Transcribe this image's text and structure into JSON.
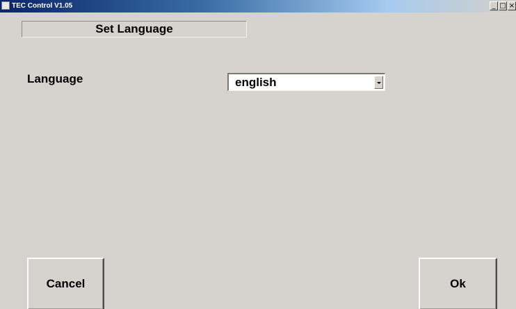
{
  "window": {
    "title": "TEC Control V1.05",
    "icon": "app-icon",
    "controls": {
      "minimize": "_",
      "maximize": "□",
      "close": "×"
    }
  },
  "header": {
    "title": "Set Language"
  },
  "language": {
    "label": "Language",
    "selected": "english"
  },
  "buttons": {
    "cancel": "Cancel",
    "ok": "Ok"
  },
  "colors": {
    "background": "#d6d3ce",
    "titlebar_start": "#0a246a",
    "titlebar_end": "#d4d0c8"
  }
}
